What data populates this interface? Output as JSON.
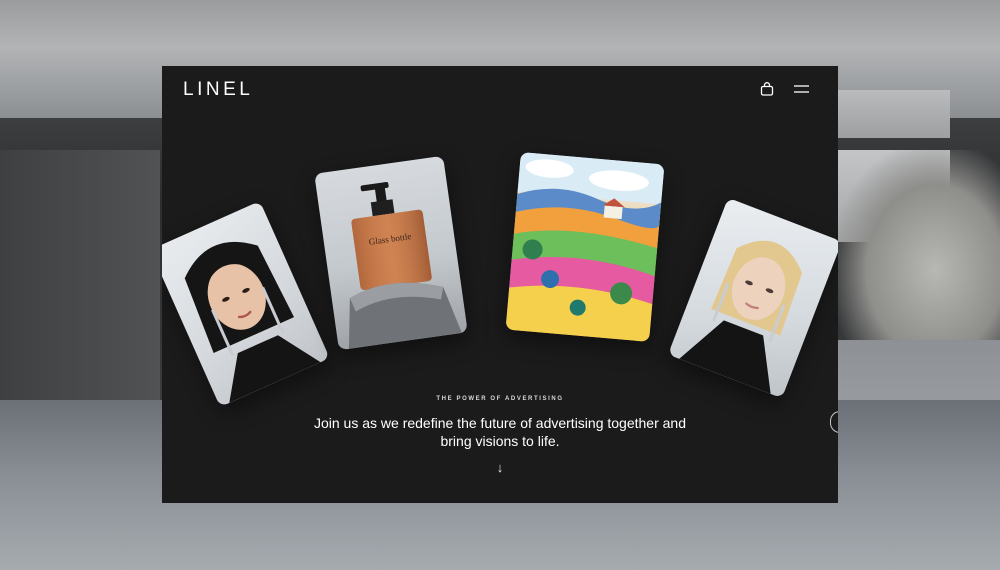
{
  "brand": {
    "logo": "LINEL"
  },
  "header": {
    "cart_icon": "shopping-bag-icon",
    "menu_icon": "hamburger-menu-icon"
  },
  "cards": [
    {
      "subject": "woman-with-earrings-portrait"
    },
    {
      "subject": "pump-bottle-product",
      "label": "Glass bottle"
    },
    {
      "subject": "colorful-landscape-painting"
    },
    {
      "subject": "blonde-woman-portrait"
    }
  ],
  "hero": {
    "eyebrow": "THE POWER OF ADVERTISING",
    "headline": "Join us as we redefine the future of advertising together and bring visions to life.",
    "scroll_icon": "arrow-down-icon",
    "scroll_glyph": "↓"
  },
  "colors": {
    "site_background": "#1b1b1c",
    "text_primary": "#ffffff"
  }
}
